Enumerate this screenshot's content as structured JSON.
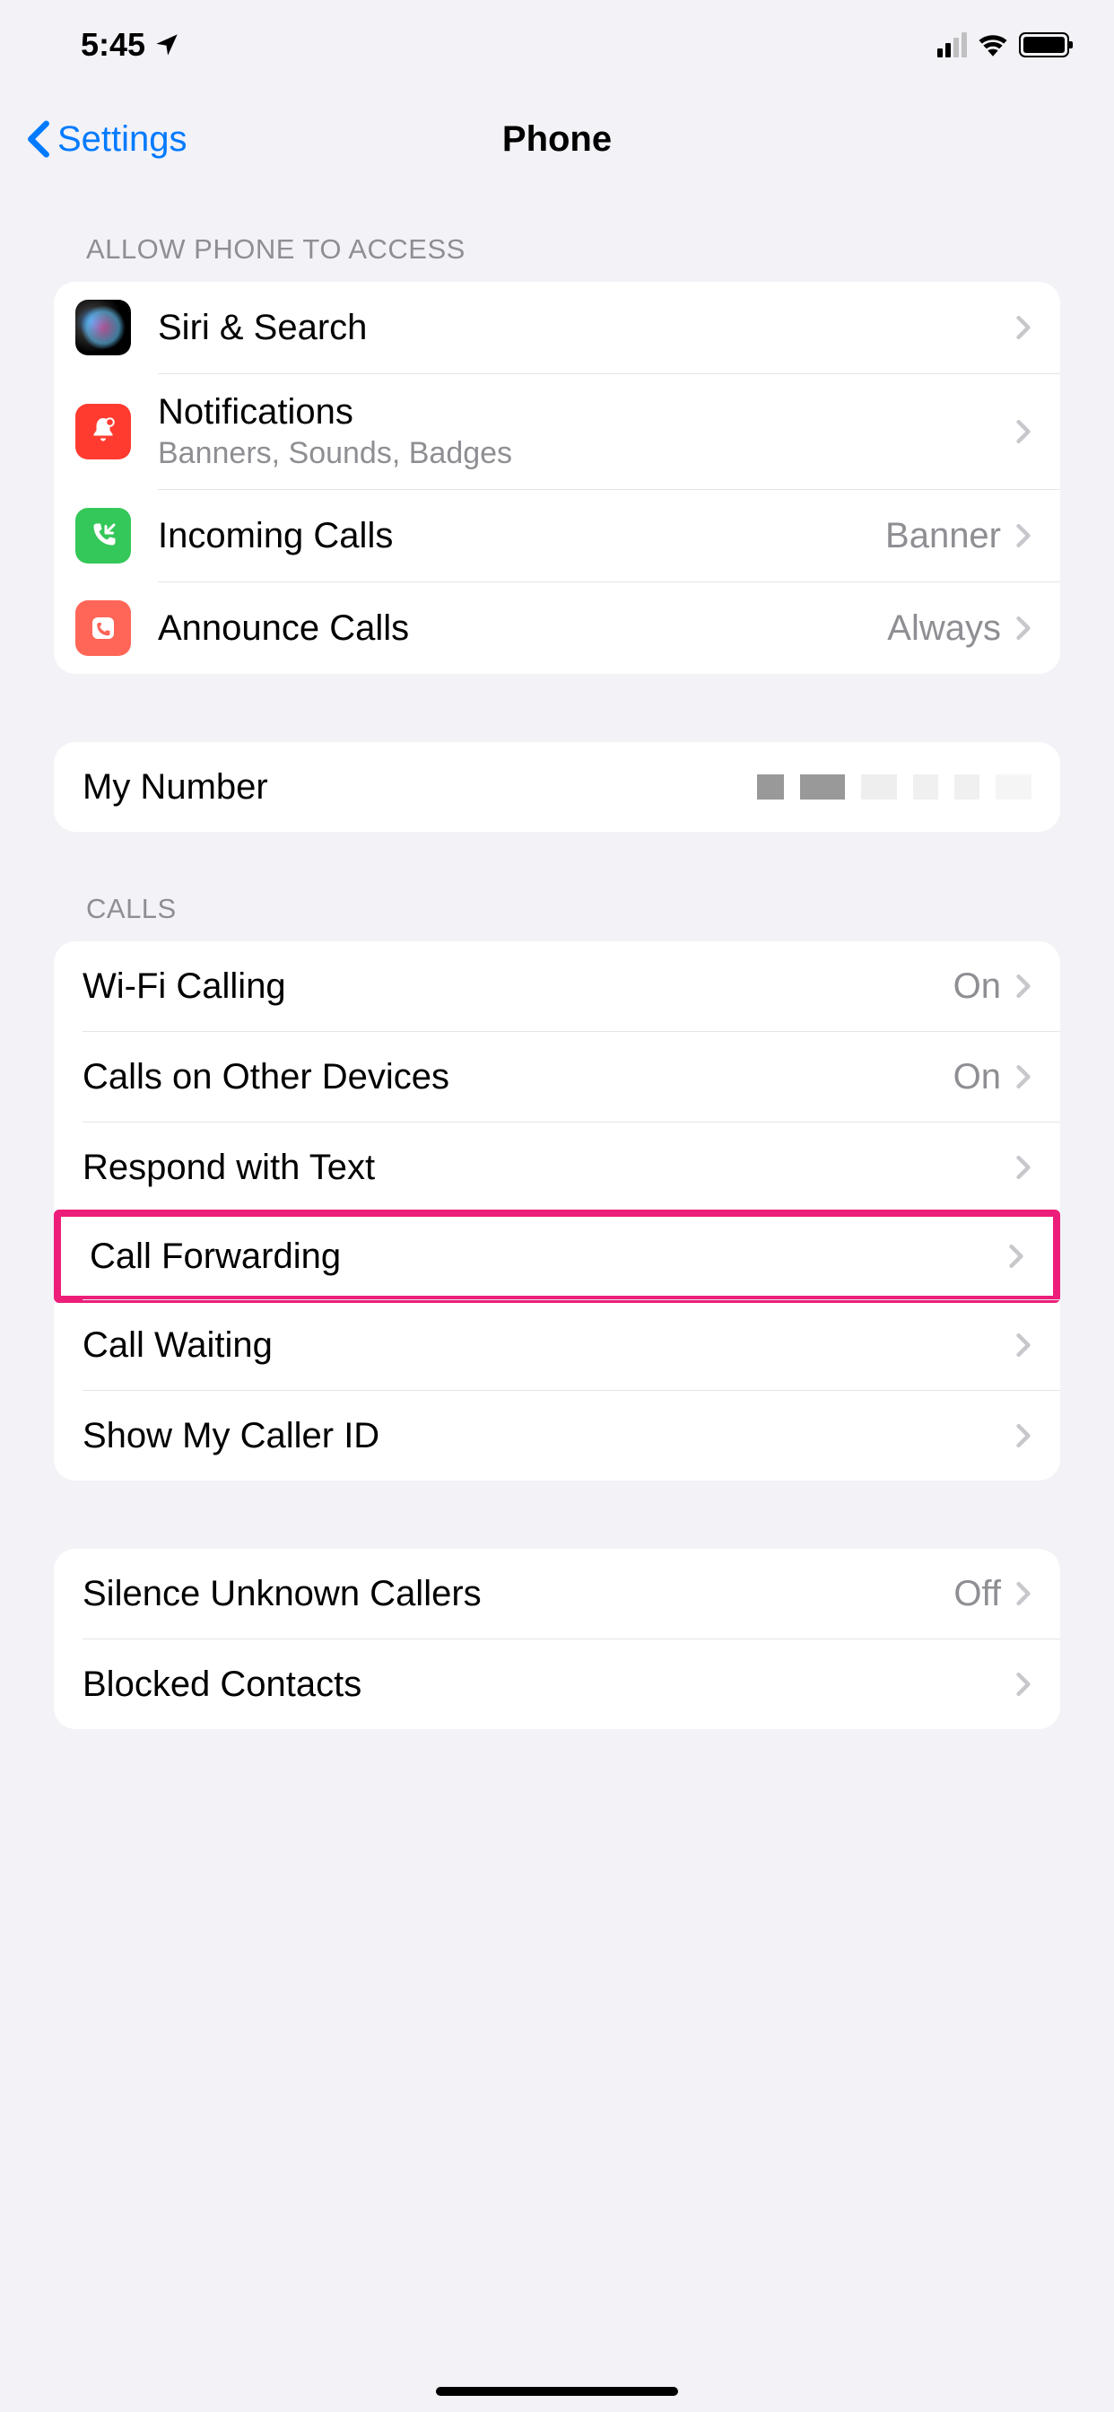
{
  "status": {
    "time": "5:45"
  },
  "nav": {
    "back": "Settings",
    "title": "Phone"
  },
  "sections": {
    "access": {
      "header": "Allow Phone to Access",
      "siri": "Siri & Search",
      "notifications": "Notifications",
      "notifications_sub": "Banners, Sounds, Badges",
      "incoming": "Incoming Calls",
      "incoming_value": "Banner",
      "announce": "Announce Calls",
      "announce_value": "Always"
    },
    "number": {
      "label": "My Number"
    },
    "calls": {
      "header": "Calls",
      "wifi": "Wi-Fi Calling",
      "wifi_value": "On",
      "other_devices": "Calls on Other Devices",
      "other_devices_value": "On",
      "respond": "Respond with Text",
      "forwarding": "Call Forwarding",
      "waiting": "Call Waiting",
      "caller_id": "Show My Caller ID"
    },
    "silence": {
      "unknown": "Silence Unknown Callers",
      "unknown_value": "Off",
      "blocked": "Blocked Contacts"
    }
  }
}
